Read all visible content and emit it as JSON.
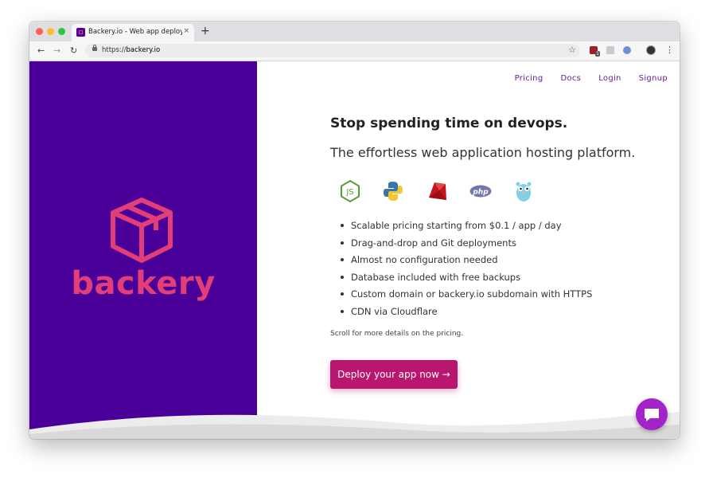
{
  "browser": {
    "tab_title": "Backery.io - Web app deploym",
    "tab_close": "×",
    "new_tab": "+",
    "url_scheme": "https://",
    "url_host": "backery.io",
    "nav_icons": [
      "back-arrow-icon",
      "forward-arrow-icon",
      "reload-icon"
    ],
    "back_glyph": "←",
    "forward_glyph": "→",
    "reload_glyph": "↻",
    "star_glyph": "☆",
    "menu_glyph": "⋮",
    "extension_badge": "1"
  },
  "nav": {
    "pricing": "Pricing",
    "docs": "Docs",
    "login": "Login",
    "signup": "Signup"
  },
  "brand": {
    "logo_text": "backery",
    "logo_color": "#e23e78",
    "panel_color": "#4a0098"
  },
  "hero": {
    "headline": "Stop spending time on devops.",
    "subhead": "The effortless web application hosting platform.",
    "languages": [
      "nodejs-icon",
      "python-icon",
      "ruby-icon",
      "php-icon",
      "go-gopher-icon"
    ],
    "php_label": "php",
    "features": [
      "Scalable pricing starting from $0.1 / app / day",
      "Drag-and-drop and Git deployments",
      "Almost no configuration needed",
      "Database included with free backups",
      "Custom domain or backery.io subdomain with HTTPS",
      "CDN via Cloudflare"
    ],
    "note": "Scroll for more details on the pricing.",
    "cta": "Deploy your app now →",
    "cta_color": "#b8166f"
  },
  "chat": {
    "icon": "chat-bubble-icon",
    "color": "#a322c9"
  }
}
